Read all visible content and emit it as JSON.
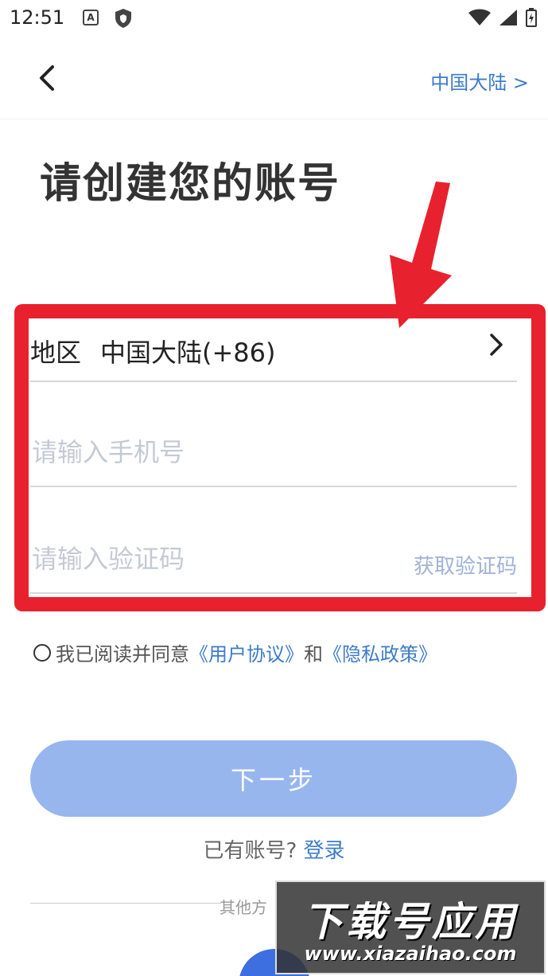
{
  "status_bar": {
    "time": "12:51",
    "notification_letter": "A"
  },
  "nav": {
    "back_icon": "chevron-left-icon",
    "region_link": "中国大陆 >"
  },
  "title": "请创建您的账号",
  "form": {
    "region_label": "地区",
    "region_value": "中国大陆(+86)",
    "phone_placeholder": "请输入手机号",
    "code_placeholder": "请输入验证码",
    "get_code_label": "获取验证码"
  },
  "agreement": {
    "prefix": "我已阅读并同意",
    "user_agreement": "《用户协议》",
    "and": "和",
    "privacy_policy": "《隐私政策》"
  },
  "next_button": "下一步",
  "login_prompt": {
    "text": "已有账号?",
    "link": "登录"
  },
  "other_methods_label": "其他方",
  "watermark": {
    "main": "下载号应用",
    "url": "www.xiazaihao.com"
  },
  "colors": {
    "accent": "#3d7cc9",
    "button": "#98b6ee",
    "highlight": "#e8212e"
  }
}
